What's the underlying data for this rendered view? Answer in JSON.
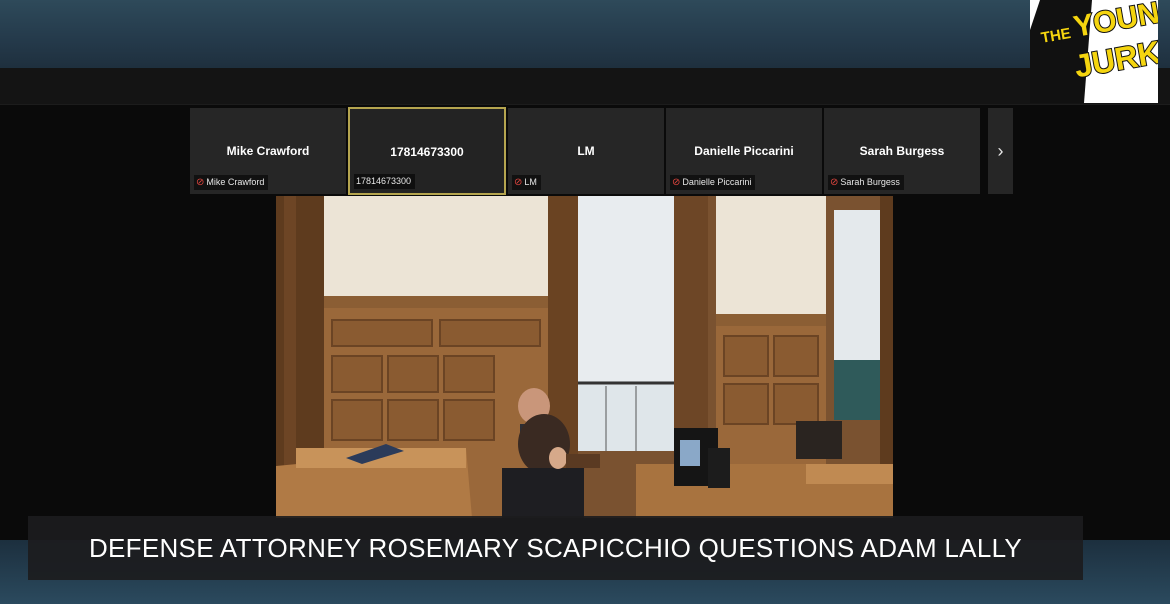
{
  "participants": [
    {
      "name": "Mike Crawford",
      "label": "Mike Crawford",
      "muted": true
    },
    {
      "name": "17814673300",
      "label": "17814673300",
      "muted": false,
      "active": true
    },
    {
      "name": "LM",
      "label": "LM",
      "muted": true
    },
    {
      "name": "Danielle Piccarini",
      "label": "Danielle Piccarini",
      "muted": true
    },
    {
      "name": "Sarah Burgess",
      "label": "Sarah Burgess",
      "muted": true
    }
  ],
  "controls": {
    "next_icon": "chevron-right-icon",
    "next_glyph": "›"
  },
  "logo": {
    "line1": "THE",
    "line2": "YOUNG",
    "line3": "JURKS"
  },
  "caption": {
    "text": "DEFENSE ATTORNEY ROSEMARY SCAPICCHIO QUESTIONS ADAM LALLY"
  },
  "colors": {
    "active_border": "#b5a54f",
    "muted_mic": "#e2463f",
    "logo_yellow": "#f5d50f"
  }
}
